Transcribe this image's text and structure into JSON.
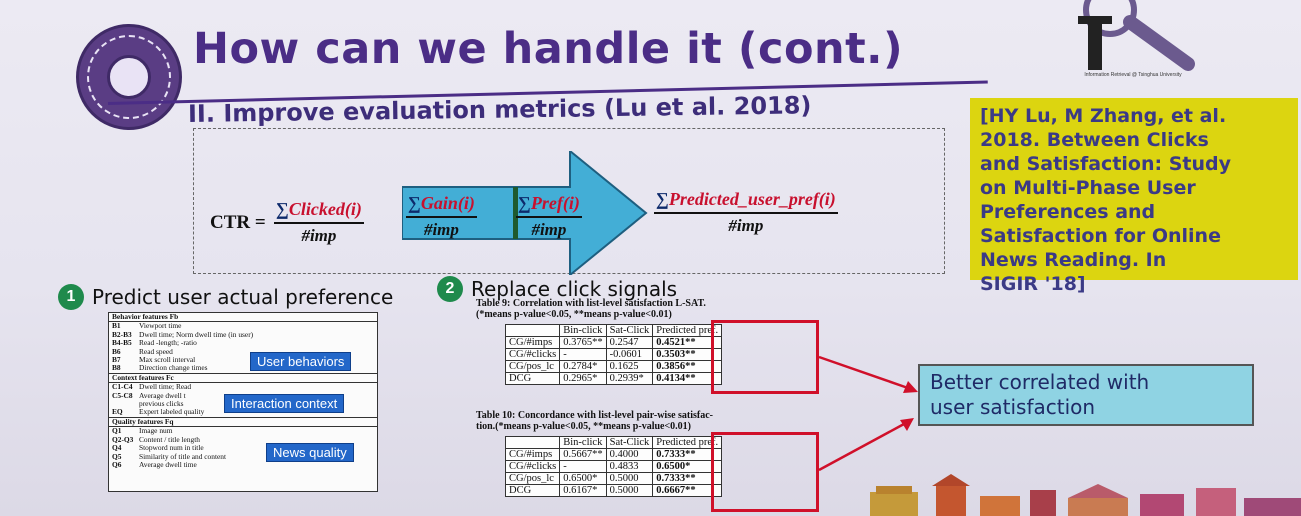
{
  "header": {
    "title": "How can we handle it (cont.)",
    "logo_caption": "Information Retrieval @ Tsinghua University"
  },
  "section": {
    "heading": "II. Improve evaluation metrics (Lu et al. 2018)"
  },
  "reference": {
    "lines": [
      "[HY Lu, M Zhang, et al.",
      "2018. Between Clicks",
      "and Satisfaction: Study",
      "on Multi-Phase User",
      "Preferences and",
      "Satisfaction for Online",
      "News Reading. In",
      "SIGIR '18]"
    ]
  },
  "formula": {
    "ctr": "CTR =",
    "sigma": "∑",
    "clicked": "Clicked(i)",
    "gain": "Gain(i)",
    "pref": "Pref(i)",
    "predicted": "Predicted_user_pref(i)",
    "imp": "#imp"
  },
  "steps": [
    {
      "num": "1",
      "text": "Predict user actual preference"
    },
    {
      "num": "2",
      "text": "Replace click signals"
    }
  ],
  "features": {
    "groups": [
      {
        "title": "Behavior features Fb",
        "rows": [
          {
            "id": "B1",
            "desc": "Viewport time"
          },
          {
            "id": "B2-B3",
            "desc": "Dwell time; Norm dwell time (in user)"
          },
          {
            "id": "B4-B5",
            "desc": "Read -length; -ratio"
          },
          {
            "id": "B6",
            "desc": "Read speed"
          },
          {
            "id": "B7",
            "desc": "Max scroll interval"
          },
          {
            "id": "B8",
            "desc": "Direction change times"
          }
        ]
      },
      {
        "title": "Context features Fc",
        "rows": [
          {
            "id": "C1-C4",
            "desc": "Dwell time; Read"
          },
          {
            "id": "C5-C8",
            "desc": "Average dwell t"
          },
          {
            "id": "",
            "desc": "previous clicks"
          },
          {
            "id": "EQ",
            "desc": "Expert labeled quality"
          }
        ]
      },
      {
        "title": "Quality features Fq",
        "rows": [
          {
            "id": "Q1",
            "desc": "Image num"
          },
          {
            "id": "Q2-Q3",
            "desc": "Content / title length"
          },
          {
            "id": "Q4",
            "desc": "Stopword num in title"
          },
          {
            "id": "Q5",
            "desc": "Similarity of title and content"
          },
          {
            "id": "Q6",
            "desc": "Average dwell time"
          }
        ]
      }
    ],
    "tags": [
      "User behaviors",
      "Interaction context",
      "News quality"
    ]
  },
  "table9": {
    "caption_line1": "Table 9: Correlation with list-level satisfaction L-SAT.",
    "caption_line2": "(*means p-value<0.05, **means p-value<0.01)",
    "headers": [
      "",
      "Bin-click",
      "Sat-Click",
      "Predicted pref."
    ],
    "rows": [
      [
        "CG/#imps",
        "0.3765**",
        "0.2547",
        "0.4521**"
      ],
      [
        "CG/#clicks",
        "-",
        "-0.0601",
        "0.3503**"
      ],
      [
        "CG/pos_lc",
        "0.2784*",
        "0.1625",
        "0.3856**"
      ],
      [
        "DCG",
        "0.2965*",
        "0.2939*",
        "0.4134**"
      ]
    ]
  },
  "table10": {
    "caption_line1": "Table 10: Concordance with list-level pair-wise satisfac-",
    "caption_line2": "tion.(*means p-value<0.05, **means p-value<0.01)",
    "headers": [
      "",
      "Bin-click",
      "Sat-Click",
      "Predicted pref."
    ],
    "rows": [
      [
        "CG/#imps",
        "0.5667**",
        "0.4000",
        "0.7333**"
      ],
      [
        "CG/#clicks",
        "-",
        "0.4833",
        "0.6500*"
      ],
      [
        "CG/pos_lc",
        "0.6500*",
        "0.5000",
        "0.7333**"
      ],
      [
        "DCG",
        "0.6167*",
        "0.5000",
        "0.6667**"
      ]
    ]
  },
  "callout": {
    "line1": "Better correlated with",
    "line2": "user satisfaction"
  },
  "colors": {
    "title": "#4b2d86",
    "reference_bg": "#dcd510",
    "callout_bg": "#8fd3e3",
    "arrow": "#43aed6",
    "highlight": "#d0102a",
    "step_badge": "#1f8a4c",
    "tag_bg": "#2367c9"
  }
}
